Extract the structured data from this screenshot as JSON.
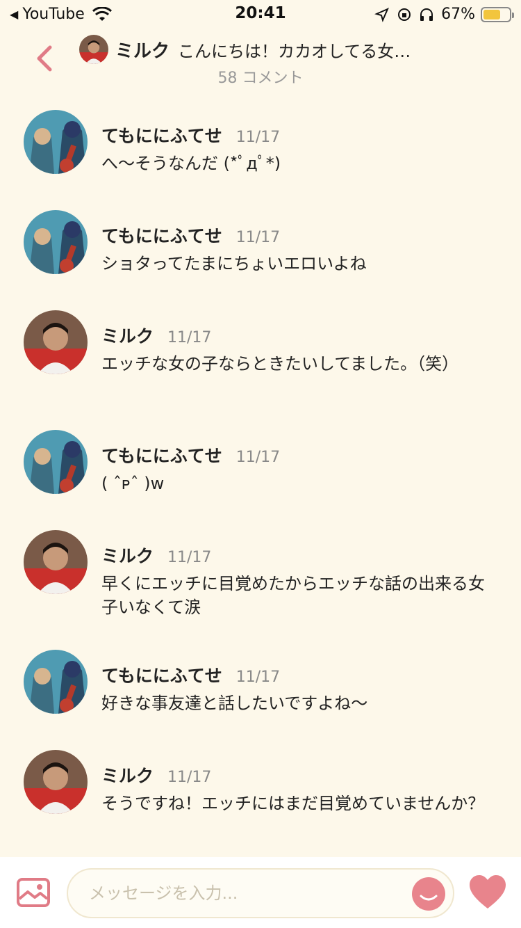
{
  "status_bar": {
    "app": "YouTube",
    "time": "20:41",
    "battery_percent": "67%",
    "battery_level": 0.67,
    "battery_color": "#f2c53d"
  },
  "header": {
    "name": "ミルク",
    "topic": "こんにちは！カカオしてる女…",
    "comments": "58 コメント"
  },
  "messages": [
    {
      "name": "てもににふてせ",
      "date": "11/17",
      "text": "へ〜そうなんだ (*ﾟдﾟ*)",
      "avatar": "avatar-temo"
    },
    {
      "name": "てもににふてせ",
      "date": "11/17",
      "text": "ショタってたまにちょいエロいよね",
      "avatar": "avatar-temo"
    },
    {
      "name": "ミルク",
      "date": "11/17",
      "text": "エッチな女の子ならときたいしてました。（笑）",
      "avatar": "avatar-milk"
    },
    {
      "name": "てもににふてせ",
      "date": "11/17",
      "text": "( ˆᴘˆ )w",
      "avatar": "avatar-temo"
    },
    {
      "name": "ミルク",
      "date": "11/17",
      "text": "早くにエッチに目覚めたからエッチな話の出来る女子いなくて涙",
      "avatar": "avatar-milk"
    },
    {
      "name": "てもににふてせ",
      "date": "11/17",
      "text": "好きな事友達と話したいですよね〜",
      "avatar": "avatar-temo"
    },
    {
      "name": "ミルク",
      "date": "11/17",
      "text": "そうですね！エッチにはまだ目覚めていませんか？",
      "avatar": "avatar-milk"
    }
  ],
  "composer": {
    "placeholder": "メッセージを入力...",
    "accent_color": "#e8848c"
  }
}
